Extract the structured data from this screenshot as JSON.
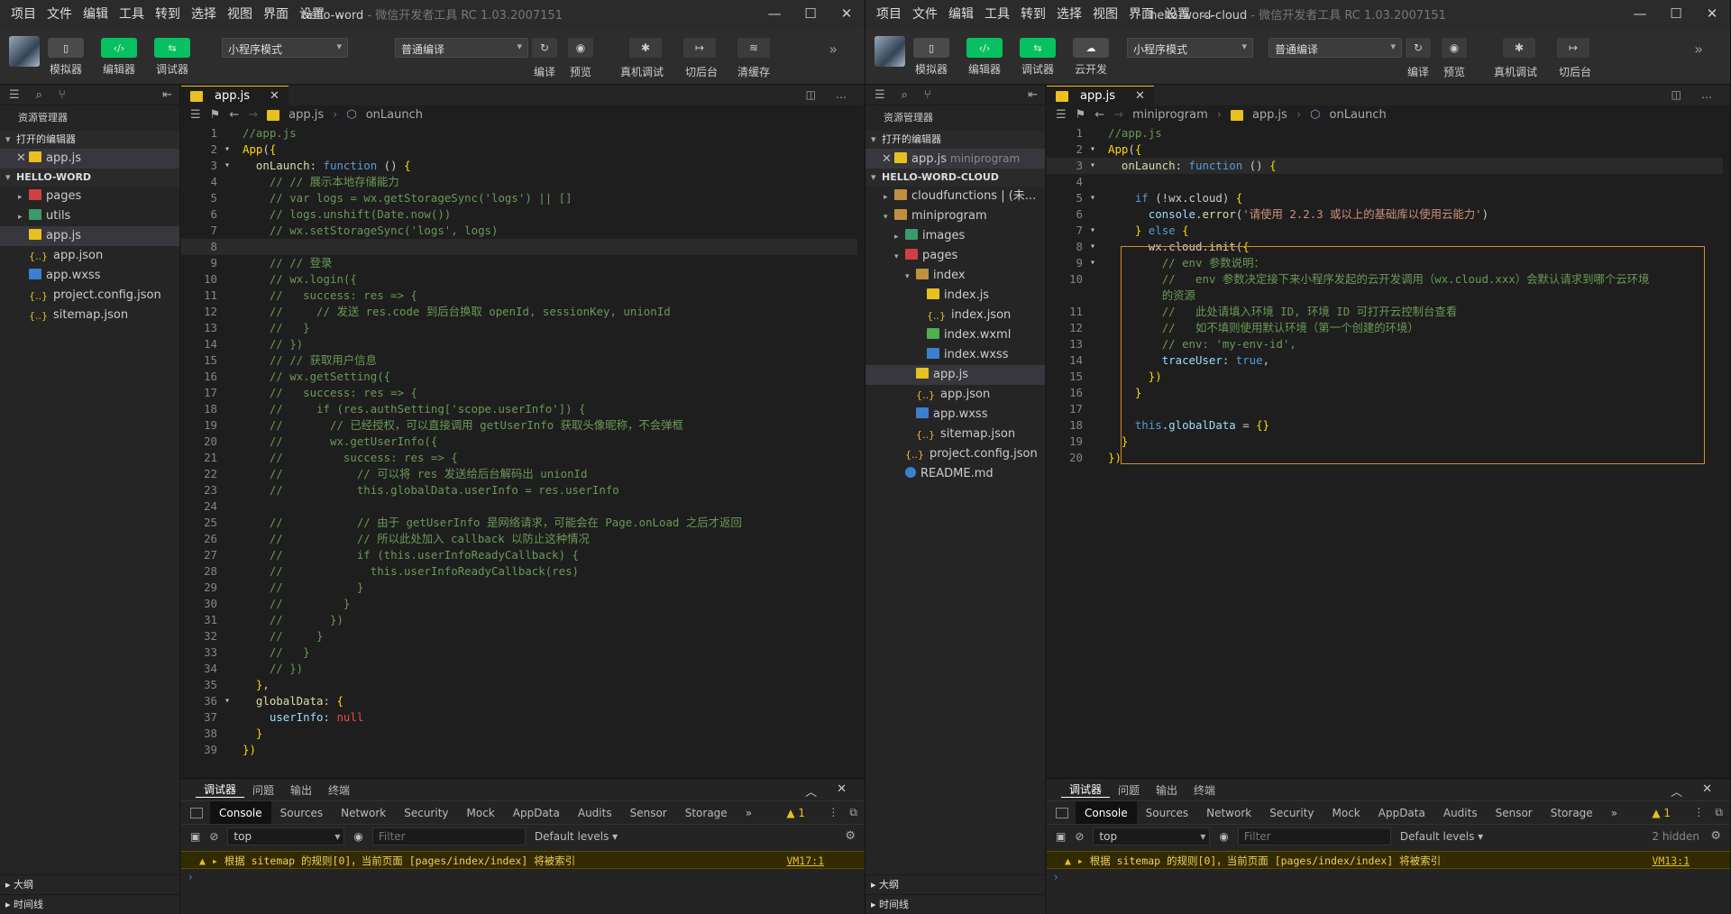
{
  "menu": [
    "项目",
    "文件",
    "编辑",
    "工具",
    "转到",
    "选择",
    "视图",
    "界面",
    "设置",
    "…"
  ],
  "left": {
    "title_name": "hello-word",
    "title_suffix": " - 微信开发者工具 RC 1.03.2007151",
    "toolbar": {
      "simulator": "模拟器",
      "editor": "编辑器",
      "debugger": "调试器",
      "mode": "小程序模式",
      "compile_mode": "普通编译",
      "compile": "编译",
      "preview": "预览",
      "real_debug": "真机调试",
      "background": "切后台",
      "clear_cache": "清缓存"
    },
    "explorer": {
      "title": "资源管理器",
      "open_editors": "打开的编辑器",
      "open_file": "app.js",
      "project": "HELLO-WORD",
      "files": [
        {
          "name": "pages",
          "type": "folder-red",
          "caret": "▸"
        },
        {
          "name": "utils",
          "type": "folder-green",
          "caret": "▸"
        },
        {
          "name": "app.js",
          "type": "js",
          "active": true
        },
        {
          "name": "app.json",
          "type": "json"
        },
        {
          "name": "app.wxss",
          "type": "wxss"
        },
        {
          "name": "project.config.json",
          "type": "json"
        },
        {
          "name": "sitemap.json",
          "type": "json"
        }
      ],
      "outline": "大纲",
      "timeline": "时间线"
    },
    "tab": "app.js",
    "crumbs": [
      "app.js",
      "onLaunch"
    ]
  },
  "right": {
    "title_name": "hello-word-cloud",
    "title_suffix": " - 微信开发者工具 RC 1.03.2007151",
    "toolbar": {
      "simulator": "模拟器",
      "editor": "编辑器",
      "debugger": "调试器",
      "cloud": "云开发",
      "mode": "小程序模式",
      "compile_mode": "普通编译",
      "compile": "编译",
      "preview": "预览",
      "real_debug": "真机调试",
      "background": "切后台"
    },
    "explorer": {
      "title": "资源管理器",
      "open_editors": "打开的编辑器",
      "open_file": "app.js",
      "open_file_desc": "miniprogram",
      "project": "HELLO-WORD-CLOUD",
      "files": [
        {
          "name": "cloudfunctions | (未...",
          "type": "folder",
          "caret": "▸",
          "indent": 0
        },
        {
          "name": "miniprogram",
          "type": "folder",
          "caret": "▾",
          "indent": 0
        },
        {
          "name": "images",
          "type": "folder-green",
          "caret": "▸",
          "indent": 1
        },
        {
          "name": "pages",
          "type": "folder-red",
          "caret": "▾",
          "indent": 1
        },
        {
          "name": "index",
          "type": "folder",
          "caret": "▾",
          "indent": 2
        },
        {
          "name": "index.js",
          "type": "js",
          "indent": 3
        },
        {
          "name": "index.json",
          "type": "json",
          "indent": 3
        },
        {
          "name": "index.wxml",
          "type": "wxml",
          "indent": 3
        },
        {
          "name": "index.wxss",
          "type": "wxss",
          "indent": 3
        },
        {
          "name": "app.js",
          "type": "js",
          "indent": 2,
          "active": true
        },
        {
          "name": "app.json",
          "type": "json",
          "indent": 2
        },
        {
          "name": "app.wxss",
          "type": "wxss",
          "indent": 2
        },
        {
          "name": "sitemap.json",
          "type": "json",
          "indent": 2
        },
        {
          "name": "project.config.json",
          "type": "json",
          "indent": 1
        },
        {
          "name": "README.md",
          "type": "info",
          "indent": 1
        }
      ],
      "outline": "大纲",
      "timeline": "时间线"
    },
    "tab": "app.js",
    "crumbs": [
      "miniprogram",
      "app.js",
      "onLaunch"
    ]
  },
  "devtools": {
    "tabs": [
      "调试器",
      "问题",
      "输出",
      "终端"
    ],
    "panels": [
      "Console",
      "Sources",
      "Network",
      "Security",
      "Mock",
      "AppData",
      "Audits",
      "Sensor",
      "Storage"
    ],
    "warn_count": "1",
    "context": "top",
    "filter_placeholder": "Filter",
    "levels": "Default levels",
    "hidden_right": "2 hidden",
    "message": "根据 sitemap 的规则[0]，当前页面 [pages/index/index] 将被索引",
    "src_left": "VM17:1",
    "src_right": "VM13:1"
  }
}
